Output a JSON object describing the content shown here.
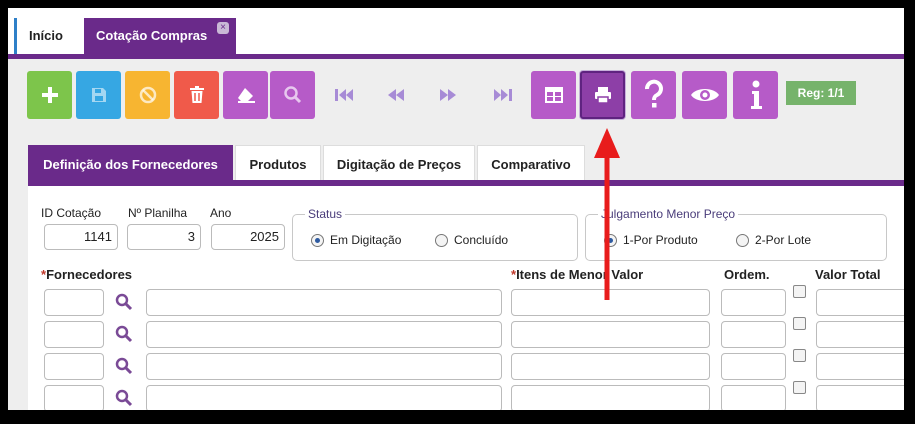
{
  "top_tabs": {
    "home": "Início",
    "active": "Cotação Compras",
    "close_symbol": "×"
  },
  "toolbar": {
    "colors": {
      "add": "#7dc54b",
      "save": "#36a7e3",
      "cancel": "#f7b531",
      "delete": "#f05a4a",
      "erase": "#b65bc8",
      "search": "#b65bc8",
      "grid": "#b65bc8",
      "print": "#8d3fa7",
      "help": "#b65bc8",
      "view": "#b65bc8",
      "info": "#b65bc8"
    },
    "record_label": "Reg: 1/1"
  },
  "inner_tabs": [
    "Definição dos Fornecedores",
    "Produtos",
    "Digitação de Preços",
    "Comparativo"
  ],
  "form": {
    "id_cotacao": {
      "label": "ID Cotação",
      "value": "1141"
    },
    "planilha": {
      "label": "Nº Planilha",
      "value": "3"
    },
    "ano": {
      "label": "Ano",
      "value": "2025"
    },
    "status": {
      "title": "Status",
      "options": [
        "Em Digitação",
        "Concluído"
      ],
      "selected": "Em Digitação"
    },
    "julgamento": {
      "title": "Julgamento Menor Preço",
      "options": [
        "1-Por Produto",
        "2-Por Lote"
      ],
      "selected": "1-Por Produto"
    }
  },
  "grid": {
    "required_mark": "*",
    "columns": {
      "fornecedores": "Fornecedores",
      "itens": "Itens de Menor Valor",
      "ordem": "Ordem.",
      "valor_total": "Valor Total"
    },
    "rows": 4
  }
}
